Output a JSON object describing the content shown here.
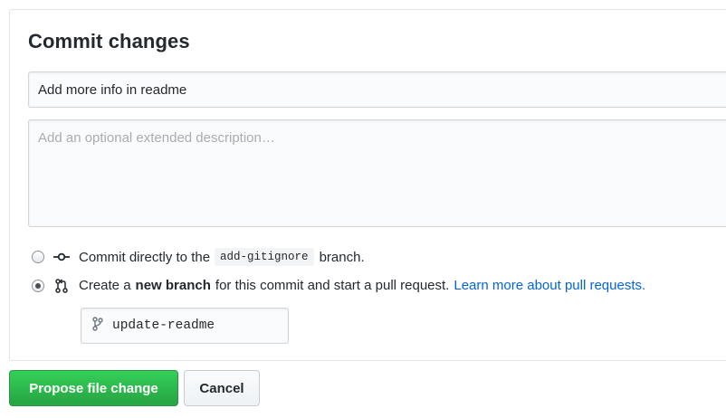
{
  "panel": {
    "title": "Commit changes",
    "summary_value": "Add more info in readme",
    "description_placeholder": "Add an optional extended description…",
    "description_value": ""
  },
  "options": {
    "direct": {
      "selected": false,
      "text_before": "Commit directly to the",
      "branch": "add-gitignore",
      "text_after": "branch."
    },
    "new_branch": {
      "selected": true,
      "text_before": "Create a",
      "bold": "new branch",
      "text_after": "for this commit and start a pull request.",
      "link": "Learn more about pull requests."
    }
  },
  "new_branch_name": "update-readme",
  "buttons": {
    "propose": "Propose file change",
    "cancel": "Cancel"
  },
  "icons": {
    "direct": "git-commit-icon",
    "new_branch": "git-pull-request-icon",
    "branch_field": "git-branch-icon"
  },
  "colors": {
    "primary": "#28a745",
    "link": "#0366d6",
    "text": "#24292e",
    "border": "#d1d5da"
  }
}
